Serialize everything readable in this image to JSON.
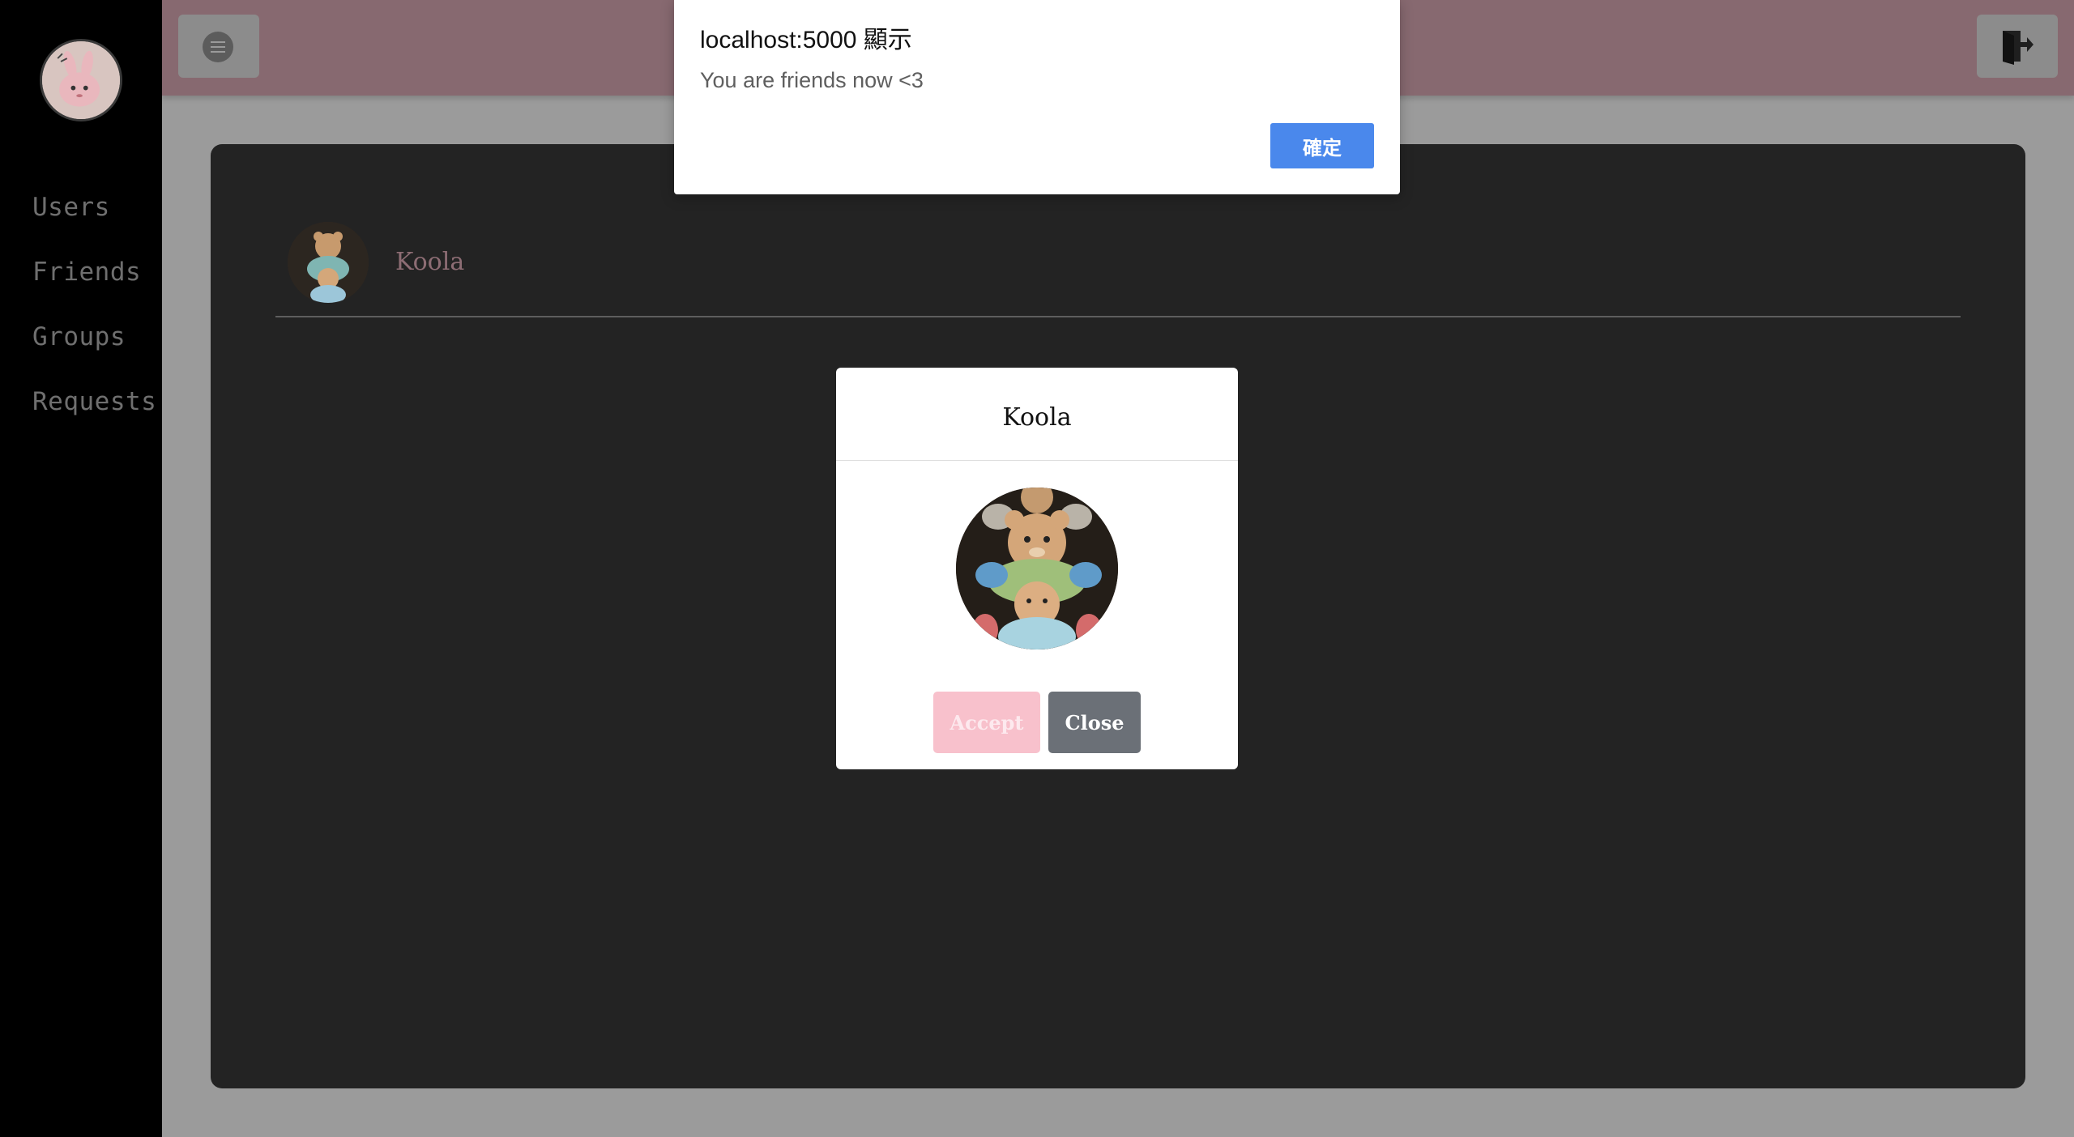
{
  "sidebar": {
    "logo_icon": "bunny-logo-icon",
    "items": [
      {
        "label": "Users"
      },
      {
        "label": "Friends"
      },
      {
        "label": "Groups"
      },
      {
        "label": "Requests"
      }
    ]
  },
  "topbar": {
    "menu_icon": "menu-icon",
    "logout_icon": "logout-icon"
  },
  "panel": {
    "friend": {
      "name": "Koola",
      "avatar_icon": "teddy-bear-avatar"
    }
  },
  "modal": {
    "title": "Koola",
    "avatar_icon": "teddy-bear-avatar",
    "accept_label": "Accept",
    "close_label": "Close"
  },
  "alert": {
    "title": "localhost:5000 顯示",
    "message": "You are friends now <3",
    "ok_label": "確定"
  },
  "colors": {
    "sidebar_bg": "#000000",
    "topbar_bg": "#876970",
    "panel_bg": "#232323",
    "accept": "#f8c1cc",
    "close": "#6b7077",
    "alert_ok": "#4a88ec",
    "friend_name": "#8d6d74"
  }
}
